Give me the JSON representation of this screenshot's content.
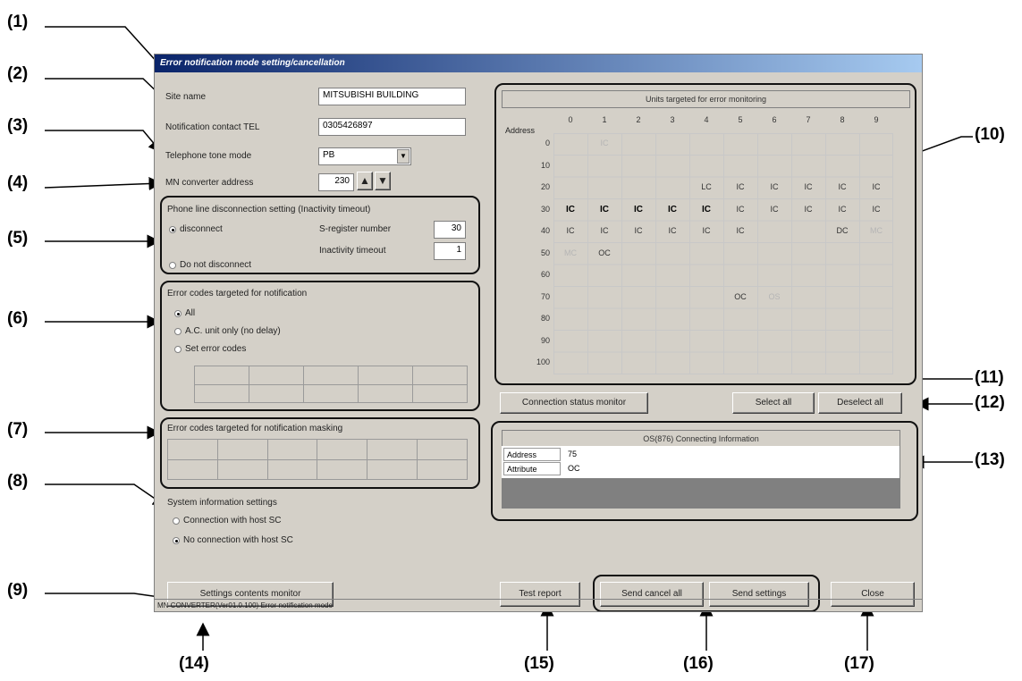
{
  "callouts": [
    "(1)",
    "(2)",
    "(3)",
    "(4)",
    "(5)",
    "(6)",
    "(7)",
    "(8)",
    "(9)",
    "(10)",
    "(11)",
    "(12)",
    "(13)",
    "(14)",
    "(15)",
    "(16)",
    "(17)"
  ],
  "window": {
    "title": "Error notification mode setting/cancellation"
  },
  "fields": {
    "site_name": {
      "label": "Site name",
      "value": "MITSUBISHI BUILDING"
    },
    "contact_tel": {
      "label": "Notification contact TEL",
      "value": "0305426897"
    },
    "tone_mode": {
      "label": "Telephone tone mode",
      "value": "PB"
    },
    "converter_address": {
      "label": "MN converter address",
      "value": "230"
    }
  },
  "phone_line": {
    "title": "Phone line disconnection setting (Inactivity timeout)",
    "opt_disconnect": "disconnect",
    "opt_no_disconnect": "Do not disconnect",
    "selected": "disconnect",
    "sreg_label": "S-register number",
    "sreg_value": "30",
    "timeout_label": "Inactivity timeout",
    "timeout_value": "1"
  },
  "error_codes": {
    "title": "Error codes targeted for notification",
    "opt_all": "All",
    "opt_ac_unit": "A.C. unit only (no delay)",
    "opt_set": "Set error codes",
    "selected": "All"
  },
  "masking": {
    "title": "Error codes targeted for notification masking"
  },
  "system_info": {
    "title": "System information settings",
    "opt_host": "Connection with host SC",
    "opt_no_host": "No connection with host SC",
    "selected": "No connection with host SC"
  },
  "units": {
    "title": "Units targeted for error monitoring",
    "address_label": "Address",
    "col_headers": [
      "0",
      "1",
      "2",
      "3",
      "4",
      "5",
      "6",
      "7",
      "8",
      "9"
    ],
    "row_headers": [
      "0",
      "10",
      "20",
      "30",
      "40",
      "50",
      "60",
      "70",
      "80",
      "90",
      "100"
    ],
    "cells": [
      [
        "",
        "IC",
        "",
        "",
        "",
        "",
        "",
        "",
        "",
        ""
      ],
      [
        "",
        "",
        "",
        "",
        "",
        "",
        "",
        "",
        "",
        ""
      ],
      [
        "",
        "",
        "",
        "",
        "LC",
        "IC",
        "IC",
        "IC",
        "IC",
        "IC"
      ],
      [
        "IC",
        "IC",
        "IC",
        "IC",
        "IC",
        "IC",
        "IC",
        "IC",
        "IC",
        "IC"
      ],
      [
        "IC",
        "IC",
        "IC",
        "IC",
        "IC",
        "IC",
        "",
        "",
        "DC",
        "MC"
      ],
      [
        "MC",
        "OC",
        "",
        "",
        "",
        "",
        "",
        "",
        "",
        ""
      ],
      [
        "",
        "",
        "",
        "",
        "",
        "",
        "",
        "",
        "",
        ""
      ],
      [
        "",
        "",
        "",
        "",
        "",
        "OC",
        "OS",
        "",
        "",
        ""
      ],
      [
        "",
        "",
        "",
        "",
        "",
        "",
        "",
        "",
        "",
        ""
      ],
      [
        "",
        "",
        "",
        "",
        "",
        "",
        "",
        "",
        "",
        ""
      ],
      [
        "",
        "",
        "",
        "",
        "",
        "",
        "",
        "",
        "",
        ""
      ]
    ],
    "bold_row": 3,
    "dim_cells": [
      "0-1",
      "4-9",
      "5-0",
      "7-6"
    ]
  },
  "buttons": {
    "connection_status": "Connection status monitor",
    "select_all": "Select all",
    "deselect_all": "Deselect all",
    "settings_monitor": "Settings contents monitor",
    "test_report": "Test report",
    "send_cancel_all": "Send cancel all",
    "send_settings": "Send settings",
    "close": "Close"
  },
  "os_info": {
    "title": "OS(876) Connecting Information",
    "address_label": "Address",
    "address_value": "75",
    "attribute_label": "Attribute",
    "attribute_value": "OC"
  },
  "status_bar": "MN CONVERTER(Ver01.0.100) Error notification mode"
}
